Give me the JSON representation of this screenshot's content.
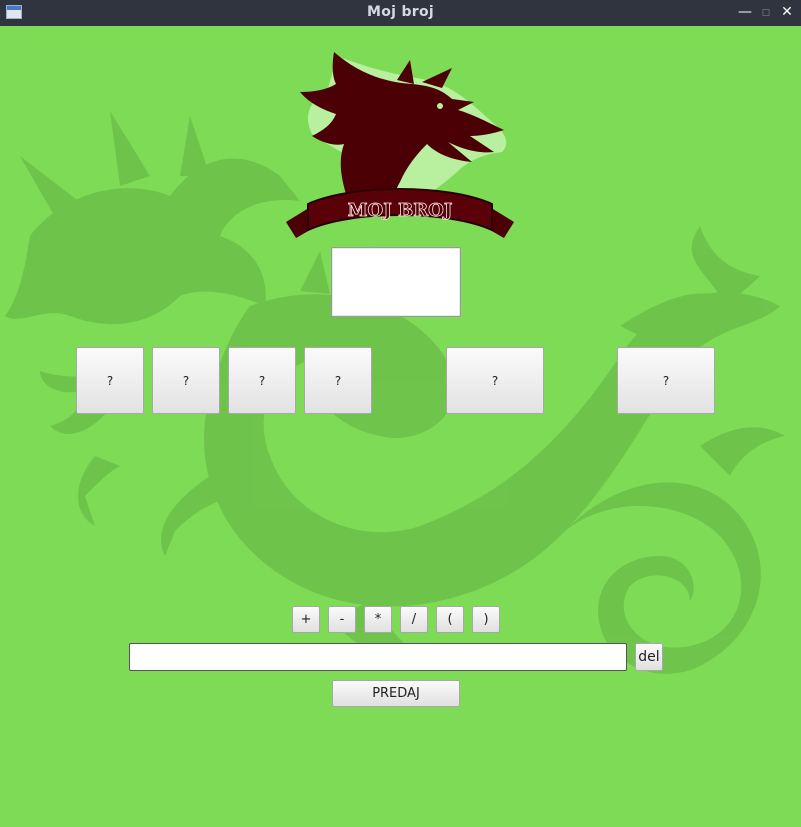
{
  "window": {
    "title": "Moj broj",
    "minimize_glyph": "—",
    "maximize_glyph": "▫",
    "close_glyph": "✕",
    "icon": "app-window-icon"
  },
  "logo": {
    "banner_text": "MOJ BROJ",
    "icon": "dragon-logo-icon",
    "colors": {
      "dragon": "#4b0005",
      "glow": "#b8f0a0"
    }
  },
  "background": {
    "color": "#7edb56",
    "watermark_icon": "dragon-watermark-icon",
    "watermark_color": "#6cc04a"
  },
  "target": {
    "value": ""
  },
  "numbers": [
    {
      "label": "?"
    },
    {
      "label": "?"
    },
    {
      "label": "?"
    },
    {
      "label": "?"
    },
    {
      "label": "?"
    },
    {
      "label": "?"
    }
  ],
  "operators": [
    {
      "label": "+"
    },
    {
      "label": "-"
    },
    {
      "label": "*"
    },
    {
      "label": "/"
    },
    {
      "label": "("
    },
    {
      "label": ")"
    }
  ],
  "expression": {
    "value": "",
    "placeholder": ""
  },
  "delete_label": "del",
  "submit_label": "PREDAJ"
}
